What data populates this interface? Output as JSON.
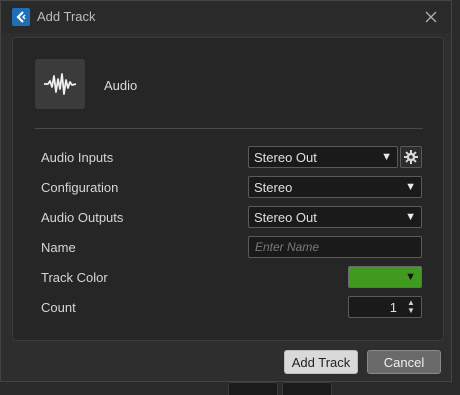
{
  "window": {
    "title": "Add Track"
  },
  "track_type": {
    "label": "Audio",
    "icon": "waveform-icon"
  },
  "form": {
    "audio_inputs": {
      "label": "Audio Inputs",
      "value": "Stereo Out"
    },
    "configuration": {
      "label": "Configuration",
      "value": "Stereo"
    },
    "audio_outputs": {
      "label": "Audio Outputs",
      "value": "Stereo Out"
    },
    "name": {
      "label": "Name",
      "placeholder": "Enter Name",
      "value": ""
    },
    "track_color": {
      "label": "Track Color",
      "color": "#3f9a1f"
    },
    "count": {
      "label": "Count",
      "value": "1"
    }
  },
  "buttons": {
    "add_track": "Add Track",
    "cancel": "Cancel"
  },
  "colors": {
    "logo_blue": "#1f6fb8",
    "background_accent": "#e2a21a"
  }
}
